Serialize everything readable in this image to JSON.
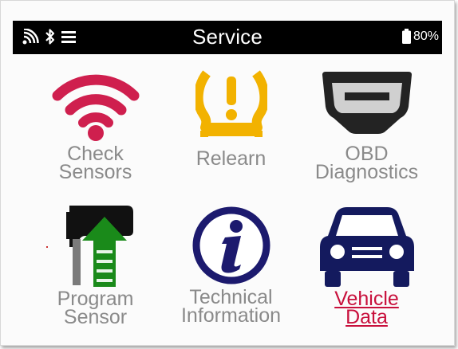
{
  "header": {
    "title": "Service",
    "battery": "80%"
  },
  "menu": {
    "check_sensors": "Check\nSensors",
    "relearn": "Relearn",
    "obd": "OBD\nDiagnostics",
    "program_sensor": "Program\nSensor",
    "technical_info": "Technical\nInformation",
    "vehicle_data": "Vehicle\nData"
  },
  "colors": {
    "accent": "#c8103c",
    "label": "#8a8a8a",
    "wifi": "#cf1f4e",
    "tpms_warning": "#f2b200",
    "navy": "#1c1a6e"
  }
}
